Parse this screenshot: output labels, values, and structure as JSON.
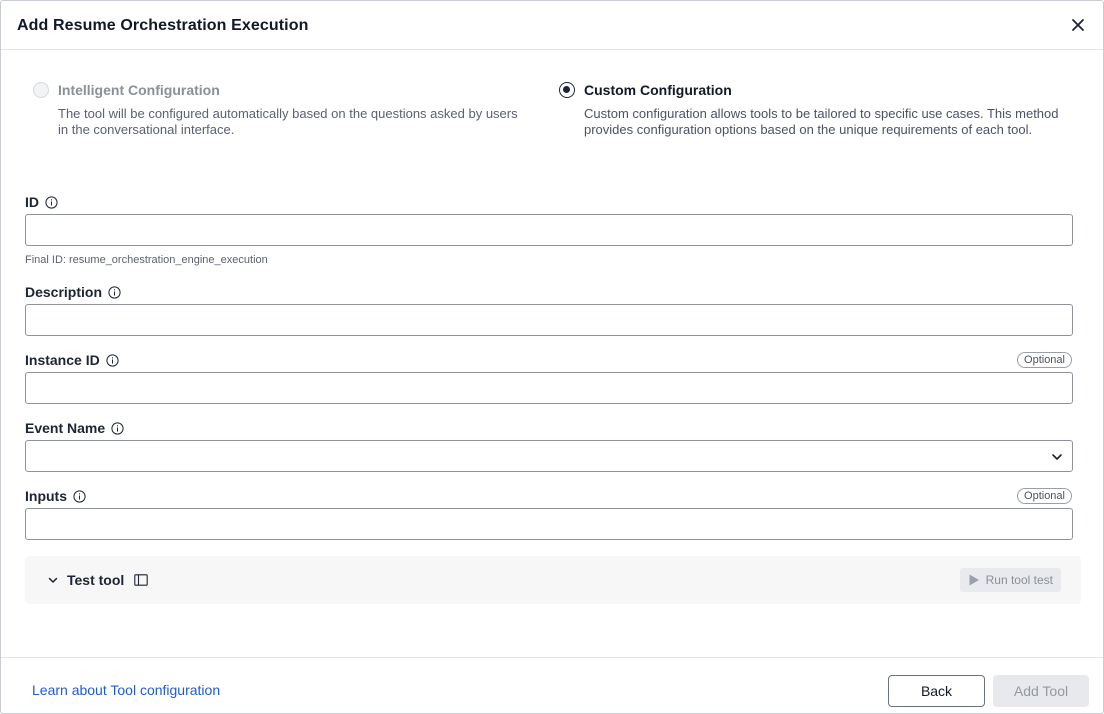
{
  "dialog": {
    "title": "Add Resume Orchestration Execution"
  },
  "config_options": {
    "intelligent": {
      "label": "Intelligent Configuration",
      "description": "The tool will be configured automatically based on the questions asked by users in the conversational interface.",
      "selected": false,
      "enabled": false
    },
    "custom": {
      "label": "Custom Configuration",
      "description": "Custom configuration allows tools to be tailored to specific use cases. This method provides configuration options based on the unique requirements of each tool.",
      "selected": true
    }
  },
  "fields": {
    "id": {
      "label": "ID",
      "value": "",
      "hint": "Final ID: resume_orchestration_engine_execution"
    },
    "description": {
      "label": "Description",
      "value": ""
    },
    "instance_id": {
      "label": "Instance ID",
      "value": "",
      "badge": "Optional"
    },
    "event_name": {
      "label": "Event Name",
      "value": ""
    },
    "inputs": {
      "label": "Inputs",
      "value": "",
      "badge": "Optional"
    }
  },
  "test_panel": {
    "label": "Test tool",
    "run_label": "Run tool test"
  },
  "footer": {
    "learn_link": "Learn about Tool configuration",
    "back_label": "Back",
    "add_label": "Add Tool"
  },
  "colors": {
    "link": "#1f5bd6",
    "text": "#1d2433",
    "disabled": "#8a8f99"
  }
}
